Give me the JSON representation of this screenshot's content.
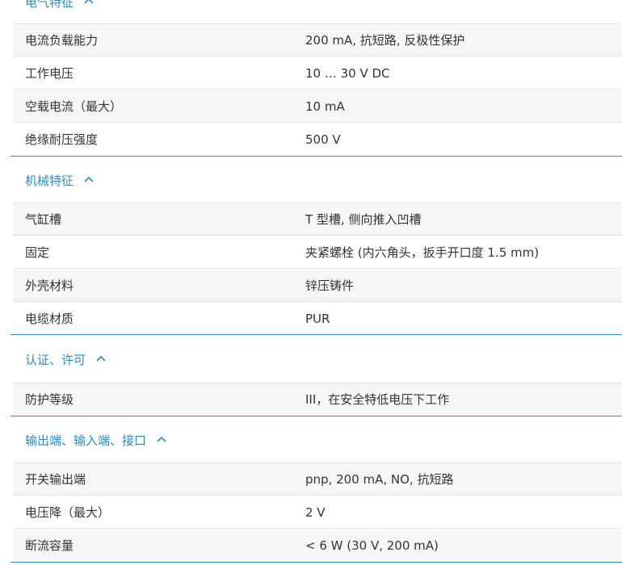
{
  "sections": [
    {
      "title": "电气特征",
      "rows": [
        {
          "label": "电流负载能力",
          "value": "200 mA, 抗短路, 反极性保护"
        },
        {
          "label": "工作电压",
          "value": "10 … 30 V DC"
        },
        {
          "label": "空载电流（最大）",
          "value": "10 mA"
        },
        {
          "label": "绝缘耐压强度",
          "value": "500 V"
        }
      ]
    },
    {
      "title": "机械特征",
      "rows": [
        {
          "label": "气缸槽",
          "value": "T 型槽, 侧向推入凹槽"
        },
        {
          "label": "固定",
          "value": "夹紧螺栓 (内六角头，扳手开口度 1.5 mm)"
        },
        {
          "label": "外壳材料",
          "value": "锌压铸件"
        },
        {
          "label": "电缆材质",
          "value": "PUR"
        }
      ]
    },
    {
      "title": "认证、许可",
      "rows": [
        {
          "label": "防护等级",
          "value": "III，在安全特低电压下工作"
        }
      ]
    },
    {
      "title": "输出端、输入端、接口",
      "rows": [
        {
          "label": "开关输出端",
          "value": "pnp, 200 mA, NO, 抗短路"
        },
        {
          "label": "电压降（最大）",
          "value": "2 V"
        },
        {
          "label": "断流容量",
          "value": "< 6 W (30 V, 200 mA)"
        }
      ]
    }
  ],
  "icons": {
    "collapse": "chevron-up-icon"
  },
  "colors": {
    "accent": "#2a8bc7",
    "row_shade": "#f6f6f6",
    "row_border": "#e2e2e2",
    "text": "#333333"
  }
}
